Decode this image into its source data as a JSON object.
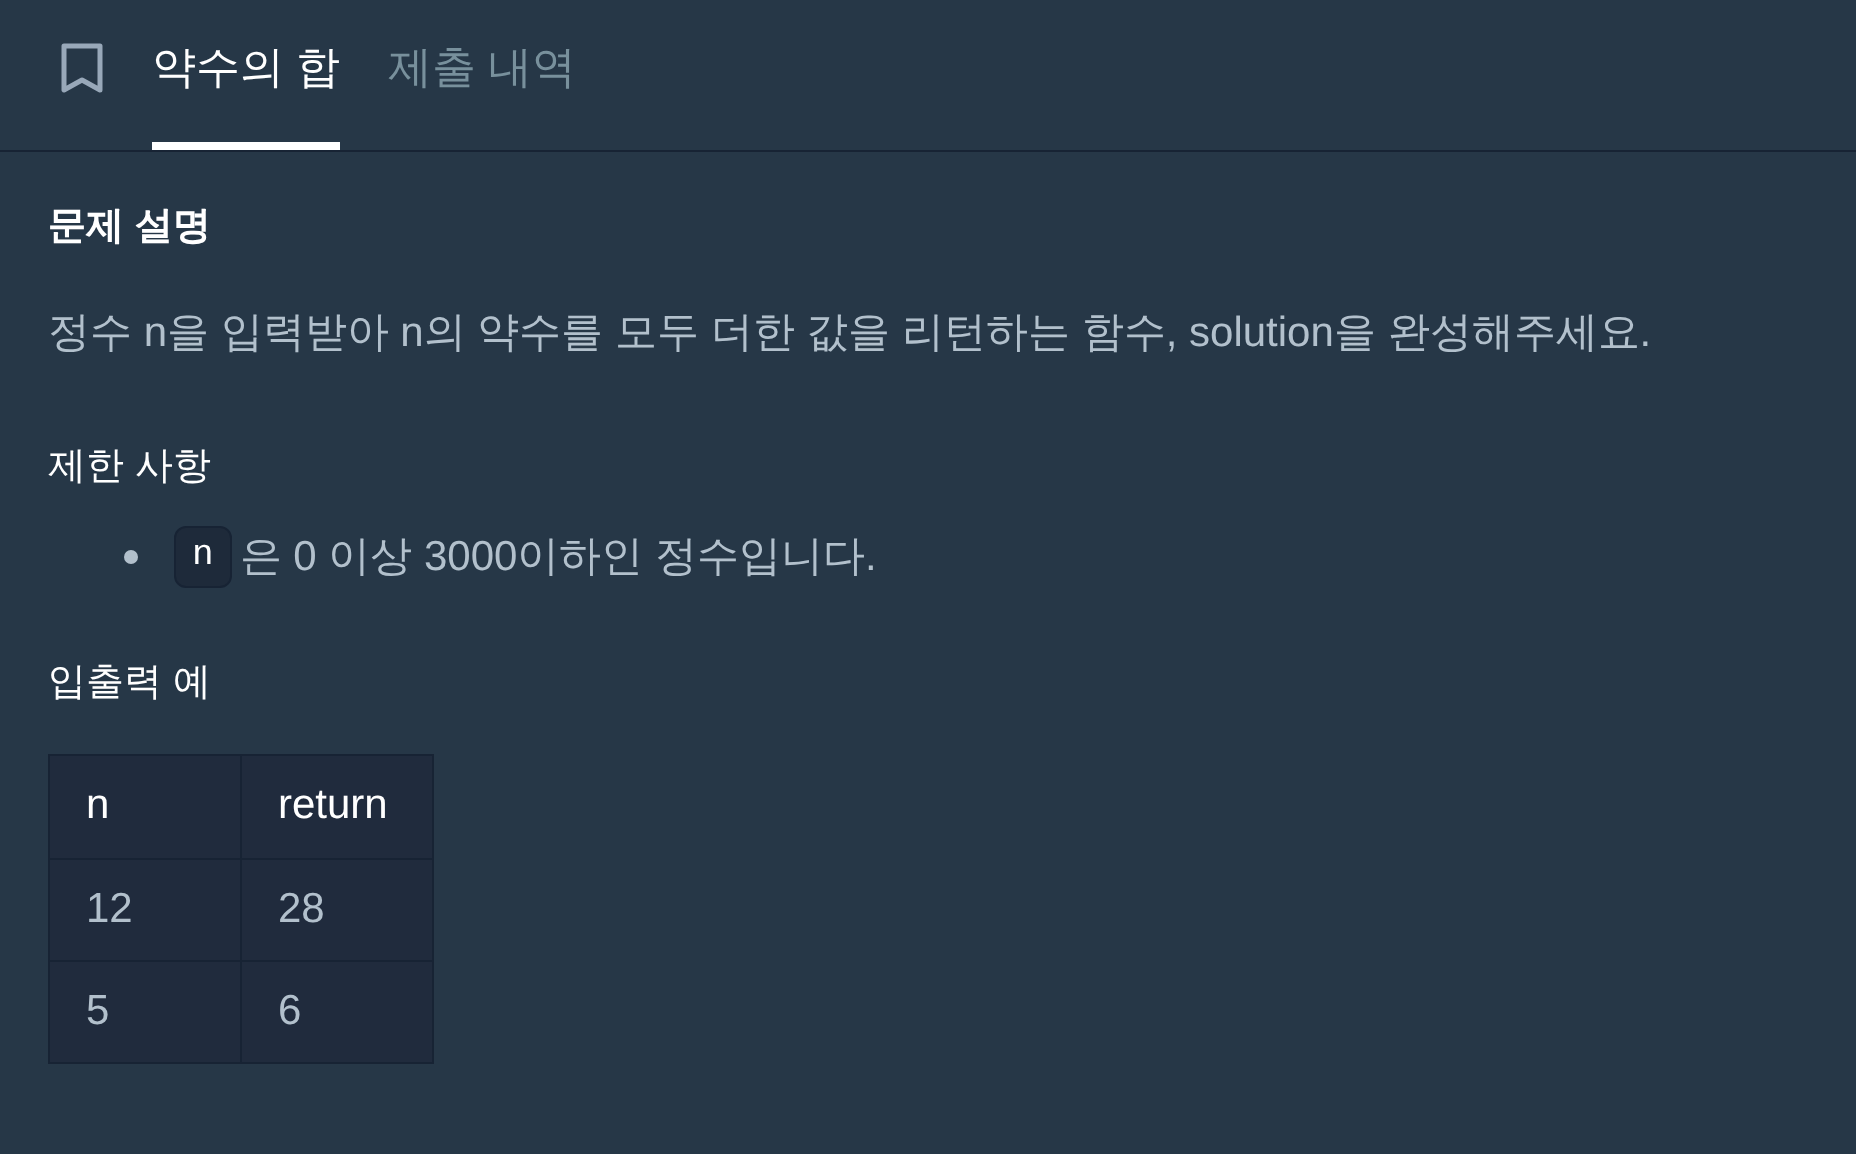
{
  "tabs": [
    {
      "label": "약수의 합",
      "selected": true
    },
    {
      "label": "제출 내역",
      "selected": false
    }
  ],
  "sections": [
    {
      "kind": "paragraph",
      "heading": "문제 설명",
      "text": "정수 n을 입력받아 n의 약수를 모두 더한 값을 리턴하는 함수, solution을 완성해주세요."
    },
    {
      "kind": "list",
      "heading": "제한 사항",
      "items": [
        {
          "code": "n",
          "text": "은 0 이상 3000이하인 정수입니다."
        }
      ]
    },
    {
      "kind": "table",
      "heading": "입출력 예",
      "columns": [
        "n",
        "return"
      ],
      "rows": [
        [
          "12",
          "28"
        ],
        [
          "5",
          "6"
        ]
      ]
    }
  ]
}
